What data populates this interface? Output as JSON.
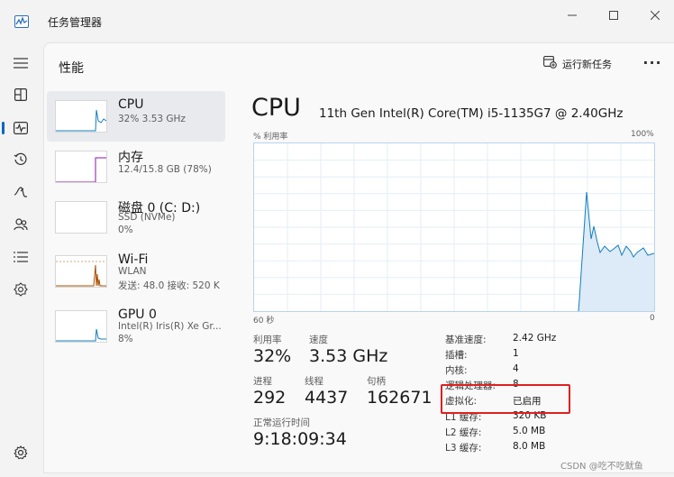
{
  "window": {
    "title": "任务管理器",
    "controls": {
      "minimize": "—",
      "maximize": "☐",
      "close": "✕"
    }
  },
  "nav": {
    "items": [
      {
        "icon": "hamburger-menu-icon",
        "active": false
      },
      {
        "icon": "processes-icon",
        "active": false
      },
      {
        "icon": "performance-icon",
        "active": true
      },
      {
        "icon": "app-history-icon",
        "active": false
      },
      {
        "icon": "startup-apps-icon",
        "active": false
      },
      {
        "icon": "users-icon",
        "active": false
      },
      {
        "icon": "details-icon",
        "active": false
      },
      {
        "icon": "services-icon",
        "active": false
      },
      {
        "icon": "settings-icon",
        "active": false
      }
    ]
  },
  "header": {
    "title": "性能",
    "run_new_task": "运行新任务",
    "more": "···"
  },
  "resources": [
    {
      "name": "CPU",
      "line1": "32% 3.53 GHz",
      "line2": "",
      "selected": true,
      "color": "#117dbb"
    },
    {
      "name": "内存",
      "line1": "12.4/15.8 GB (78%)",
      "line2": "",
      "selected": false,
      "color": "#8b12ae"
    },
    {
      "name": "磁盘 0 (C: D:)",
      "line1": "SSD (NVMe)",
      "line2": "0%",
      "selected": false,
      "color": "#4da60c"
    },
    {
      "name": "Wi-Fi",
      "line1": "WLAN",
      "line2": "发送: 48.0  接收: 520 K",
      "selected": false,
      "color": "#a74f01"
    },
    {
      "name": "GPU 0",
      "line1": "Intel(R) Iris(R) Xe Gr...",
      "line2": "8%",
      "selected": false,
      "color": "#117dbb"
    }
  ],
  "detail": {
    "title": "CPU",
    "model": "11th Gen Intel(R) Core(TM) i5-1135G7 @ 2.40GHz",
    "graph_y_label": "% 利用率",
    "graph_y_max": "100%",
    "graph_x_left": "60 秒",
    "graph_x_right": "0",
    "stats": {
      "utilization_label": "利用率",
      "utilization_value": "32%",
      "speed_label": "速度",
      "speed_value": "3.53 GHz",
      "processes_label": "进程",
      "processes_value": "292",
      "threads_label": "线程",
      "threads_value": "4437",
      "handles_label": "句柄",
      "handles_value": "162671",
      "uptime_label": "正常运行时间",
      "uptime_value": "9:18:09:34"
    },
    "specs": [
      {
        "label": "基准速度:",
        "value": "2.42 GHz"
      },
      {
        "label": "插槽:",
        "value": "1"
      },
      {
        "label": "内核:",
        "value": "4"
      },
      {
        "label": "逻辑处理器:",
        "value": "8"
      },
      {
        "label": "虚拟化:",
        "value": "已启用"
      },
      {
        "label": "L1 缓存:",
        "value": "320 KB"
      },
      {
        "label": "L2 缓存:",
        "value": "5.0 MB"
      },
      {
        "label": "L3 缓存:",
        "value": "8.0 MB"
      }
    ]
  },
  "watermark": "CSDN @吃不吃鱿鱼",
  "accent_color": "#0067c0",
  "cpu_graph_color": "#117dbb",
  "highlight_color": "#e02020"
}
